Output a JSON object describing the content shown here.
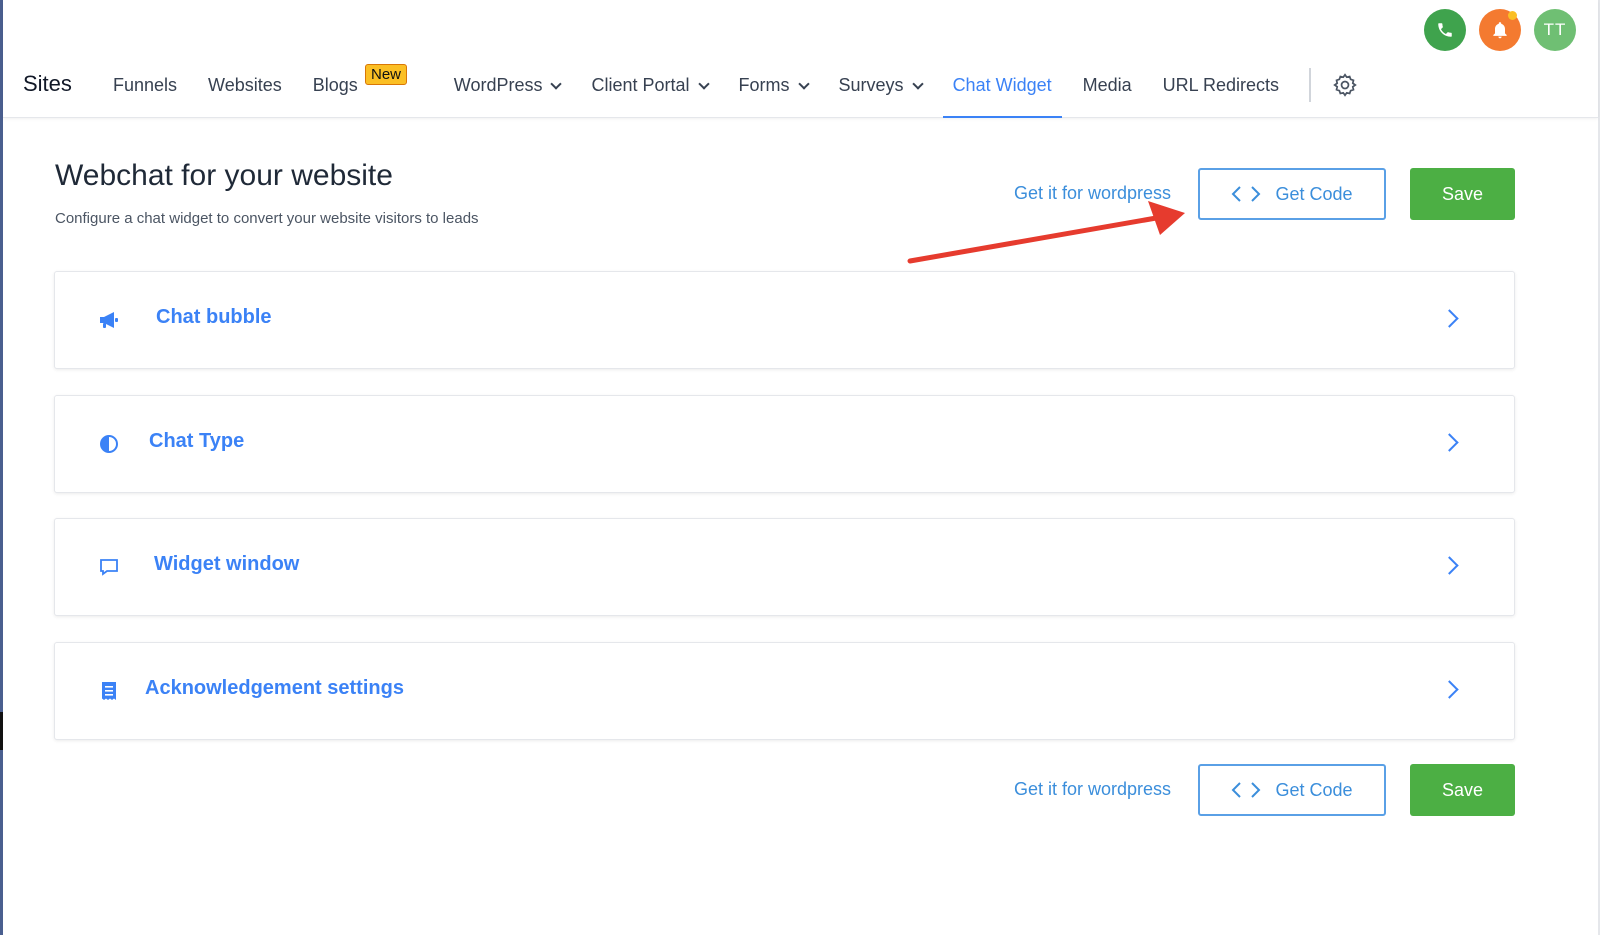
{
  "topbar": {
    "icons": [
      "phone-icon",
      "bell-icon"
    ],
    "avatar_initials": "TT",
    "brand": "Sites",
    "nav": [
      {
        "label": "Funnels"
      },
      {
        "label": "Websites"
      },
      {
        "label": "Blogs"
      },
      {
        "label": "WordPress",
        "dropdown": true
      },
      {
        "label": "Client Portal",
        "dropdown": true
      },
      {
        "label": "Forms",
        "dropdown": true
      },
      {
        "label": "Surveys",
        "dropdown": true
      },
      {
        "label": "Chat Widget",
        "active": true
      },
      {
        "label": "Media"
      },
      {
        "label": "URL Redirects"
      }
    ],
    "new_badge": "New"
  },
  "header": {
    "title": "Webchat for your website",
    "subtitle": "Configure a chat widget to convert your website visitors to leads",
    "wp_link": "Get it for wordpress",
    "get_code": "Get Code",
    "save": "Save"
  },
  "sections": [
    {
      "label": "Chat bubble",
      "icon": "megaphone-icon"
    },
    {
      "label": "Chat Type",
      "icon": "contrast-icon"
    },
    {
      "label": "Widget window",
      "icon": "chat-window-icon"
    },
    {
      "label": "Acknowledgement settings",
      "icon": "receipt-icon"
    }
  ],
  "footer": {
    "wp_link": "Get it for wordpress",
    "get_code": "Get Code",
    "save": "Save"
  },
  "colors": {
    "accent": "#3b82f6",
    "save_green": "#4caf44",
    "phone_green": "#3fa34d",
    "bell_orange": "#f47a30",
    "avatar_green": "#6fbf73",
    "annotation_arrow": "#e63b2e"
  }
}
